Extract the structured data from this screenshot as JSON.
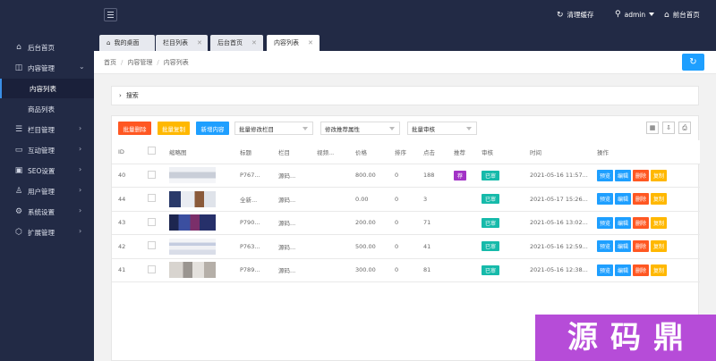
{
  "topbar": {
    "clear_cache": "清理缓存",
    "user": "admin",
    "frontend": "前台首页"
  },
  "sidebar": {
    "items": [
      {
        "label": "后台首页",
        "icon": "home-icon"
      },
      {
        "label": "内容管理",
        "icon": "columns-icon"
      },
      {
        "label": "栏目管理",
        "icon": "list-icon"
      },
      {
        "label": "互动管理",
        "icon": "chat-icon"
      },
      {
        "label": "SEO设置",
        "icon": "monitor-icon"
      },
      {
        "label": "用户管理",
        "icon": "user-icon"
      },
      {
        "label": "系统设置",
        "icon": "gear-icon"
      },
      {
        "label": "扩展管理",
        "icon": "extension-icon"
      }
    ],
    "subitems": [
      {
        "label": "内容列表"
      },
      {
        "label": "商品列表"
      }
    ]
  },
  "tabs": [
    {
      "label": "我的桌面"
    },
    {
      "label": "栏目列表"
    },
    {
      "label": "后台首页"
    },
    {
      "label": "内容列表"
    }
  ],
  "breadcrumb": {
    "home": "首页",
    "section": "内容管理",
    "page": "内容列表"
  },
  "search": {
    "label": "搜索"
  },
  "toolbar": {
    "batch_delete": "批量删除",
    "batch_copy": "批量复制",
    "add_content": "新增内容",
    "batch_change_column": "批量修改栏目",
    "change_recommend": "修改推荐属性",
    "batch_review": "批量审核"
  },
  "colors": {
    "sidebar": "#222a45",
    "blue": "#1e9fff",
    "green": "#16b777",
    "red": "#ff5722",
    "orange": "#ffb800",
    "purple": "#a233c6",
    "watermark": "#b64cd8"
  },
  "table": {
    "headers": [
      "ID",
      "",
      "缩略图",
      "标题",
      "栏目",
      "视频...",
      "价格",
      "排序",
      "点击",
      "推荐",
      "审核",
      "时间",
      "操作"
    ],
    "rows": [
      {
        "id": "40",
        "title": "P767...",
        "column": "源码...",
        "price": "800.00",
        "sort": "0",
        "clicks": "188",
        "recommend": "荐",
        "status": "已审",
        "time": "2021-05-16 11:57..."
      },
      {
        "id": "44",
        "title": "全新...",
        "column": "源码...",
        "price": "0.00",
        "sort": "0",
        "clicks": "3",
        "recommend": "",
        "status": "已审",
        "time": "2021-05-17 15:26..."
      },
      {
        "id": "43",
        "title": "P790...",
        "column": "源码...",
        "price": "200.00",
        "sort": "0",
        "clicks": "71",
        "recommend": "",
        "status": "已审",
        "time": "2021-05-16 13:02..."
      },
      {
        "id": "42",
        "title": "P763...",
        "column": "源码...",
        "price": "500.00",
        "sort": "0",
        "clicks": "41",
        "recommend": "",
        "status": "已审",
        "time": "2021-05-16 12:59..."
      },
      {
        "id": "41",
        "title": "P789...",
        "column": "源码...",
        "price": "300.00",
        "sort": "0",
        "clicks": "81",
        "recommend": "",
        "status": "已审",
        "time": "2021-05-16 12:38..."
      }
    ],
    "actions": [
      "预览",
      "编辑",
      "删除",
      "复制"
    ]
  },
  "watermark": {
    "chars": [
      "源",
      "码",
      "鼎"
    ]
  }
}
